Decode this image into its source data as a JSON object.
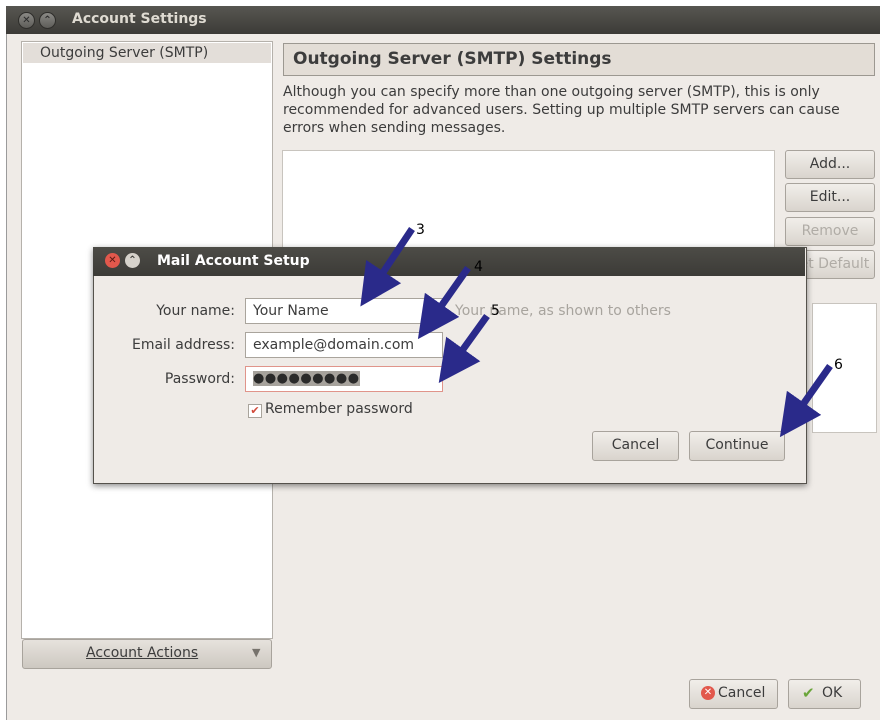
{
  "window": {
    "title": "Account Settings"
  },
  "sidebar": {
    "items": [
      {
        "label": "Outgoing Server (SMTP)"
      }
    ],
    "account_actions_label": "Account Actions"
  },
  "main": {
    "heading": "Outgoing Server (SMTP) Settings",
    "description": "Although you can specify more than one outgoing server (SMTP), this is only recommended for advanced users. Setting up multiple SMTP servers can cause errors when sending messages.",
    "buttons": {
      "add": "Add...",
      "edit": "Edit...",
      "remove": "Remove",
      "set_default": "Set Default"
    }
  },
  "dialog": {
    "title": "Mail Account Setup",
    "name_label": "Your name:",
    "name_value": "Your Name",
    "name_hint": "Your name, as shown to others",
    "email_label": "Email address:",
    "email_value": "example@domain.com",
    "password_label": "Password:",
    "password_mask": "●●●●●●●●●",
    "remember_label": "Remember password",
    "remember_checked": true,
    "cancel_label": "Cancel",
    "continue_label": "Continue"
  },
  "footer": {
    "cancel_label": "Cancel",
    "ok_label": "OK"
  },
  "annotations": [
    "3",
    "4",
    "5",
    "6"
  ],
  "colors": {
    "arrow": "#2a2a8a",
    "titlebar": "#3c3b37",
    "window_bg": "#efebe7",
    "close_button": "#e2584c"
  }
}
